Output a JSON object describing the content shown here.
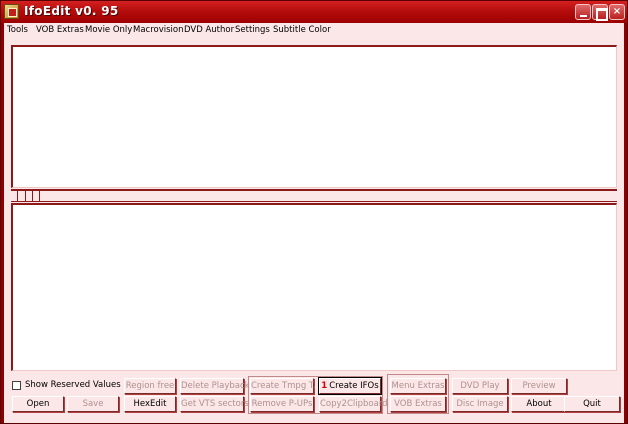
{
  "window": {
    "title": "IfoEdit v0. 95"
  },
  "menu": {
    "items": [
      {
        "label": "Tools"
      },
      {
        "label": "VOB Extras"
      },
      {
        "label": "Movie Only"
      },
      {
        "label": "Macrovision"
      },
      {
        "label": "DVD Author"
      },
      {
        "label": "Settings"
      },
      {
        "label": "Subtitle Color"
      }
    ]
  },
  "options": {
    "show_reserved_values": {
      "label": "Show Reserved Values",
      "checked": false
    }
  },
  "buttons": {
    "region_free": {
      "label": "Region free",
      "enabled": false
    },
    "delete_playback": {
      "label": "Delete Playback",
      "enabled": false
    },
    "create_tmpg": {
      "label": "Create Tmpg T.",
      "enabled": false
    },
    "create_ifos": {
      "label": "Create IFOs",
      "badge": "1",
      "enabled": true
    },
    "menu_extras": {
      "label": "Menu Extras",
      "enabled": false
    },
    "dvd_play": {
      "label": "DVD Play",
      "enabled": false
    },
    "preview": {
      "label": "Preview",
      "enabled": false
    },
    "open": {
      "label": "Open",
      "enabled": true
    },
    "save": {
      "label": "Save",
      "enabled": false
    },
    "hexedit": {
      "label": "HexEdit",
      "enabled": true
    },
    "get_vts_sectors": {
      "label": "Get VTS sectors",
      "enabled": false
    },
    "remove_pups": {
      "label": "Remove P-UPs",
      "enabled": false
    },
    "copy2clipboard": {
      "label": "Copy2Clipboard",
      "enabled": false
    },
    "vob_extras": {
      "label": "VOB Extras",
      "enabled": false
    },
    "disc_image": {
      "label": "Disc Image",
      "enabled": false
    },
    "about": {
      "label": "About",
      "enabled": true
    },
    "quit": {
      "label": "Quit",
      "enabled": true
    }
  },
  "colors": {
    "titlebar": "#b50d0d",
    "frame": "#8b0000",
    "client_bg": "#fbe7e7",
    "pane_border": "#8b1a1a"
  }
}
